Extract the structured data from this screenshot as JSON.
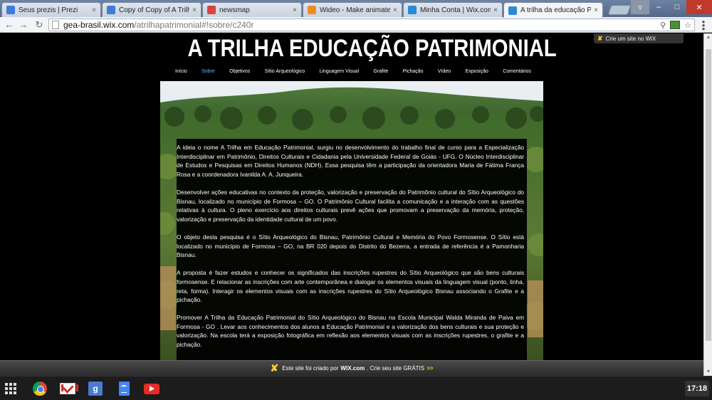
{
  "browser": {
    "tabs": [
      {
        "title": "Seus prezis | Prezi",
        "favicon": "prezi-icon",
        "color": "#3b7dd8"
      },
      {
        "title": "Copy of Copy of A Trilha E",
        "favicon": "prezi-icon",
        "color": "#3b7dd8"
      },
      {
        "title": "newsmap",
        "favicon": "newsmap-icon",
        "color": "#d8443b"
      },
      {
        "title": "Wideo - Make animated o",
        "favicon": "wideo-icon",
        "color": "#f08a24"
      },
      {
        "title": "Minha Conta | Wix.com",
        "favicon": "wix-icon",
        "color": "#2a8ad4"
      },
      {
        "title": "A trilha da educação Patrim",
        "favicon": "wix-icon",
        "color": "#2a8ad4"
      }
    ],
    "url_host": "gea-brasil.wix.com",
    "url_path": "/atrilhapatrimonial#!sobre/c240r"
  },
  "wix_create_badge": "Crie um site no WiX",
  "site": {
    "title": "A TRILHA EDUCAÇÃO PATRIMONIAL",
    "nav": [
      "Início",
      "Sobre",
      "Objetivos",
      "Sítio Arqueológico",
      "Linguagem Visual",
      "Grafite",
      "Pichação",
      "Vídeo",
      "Exposição",
      "Comentários"
    ],
    "current_nav": "Sobre",
    "paragraphs": [
      "A ideia o nome A Trilha em Educação Patrimonial, surgiu no desenvolvimento do trabalho final de curso para a Especialização Interdisciplinar em Patrimônio, Direitos Culturais e Cidadania pela Universidade Federal de Goiás - UFG. O Núcleo Interdisciplinar de Estudos e Pesquisas em Direitos Humanos (NDH).  Essa pesquisa têm a participação da orientadora Maria de Fátima França Rosa e a coordenadora Ivanilda A. A. Junqueira.",
      "Desenvolver ações educativas no contexto da proteção, valorização e preservação do Patrimônio cultural do Sítio Arqueológico do Bisnau, localizado no município de Formosa – GO. O Patrimônio Cultural facilita a comunicação e a interação com as questões relativas à cultura. O pleno exercício aos direitos culturais prevê ações que promovam a preservação da memória, proteção, valorização e preservação da identidade cultural de um povo.",
      "O objeto desta pesquisa é o Sítio Arqueológico do Bisnau, Patrimônio Cultural e Memória do Povo Formosense. O Sítio está localizado no município de Formosa – GO, na BR 020 depois do Distrito do Bezerra, a entrada de referência é a Pamonharia Bisnau.",
      "A proposta é fazer estudos e conhecer os significados das inscrições rupestres do Sítio Arqueológico que são bens culturais formosense. E relacionar as inscrições com arte contemporânea e dialogar os elementos visuais da linguagem visual (ponto, linha, reta, forma). Interagir os elementos visuais com as inscrições rupestres do Sítio Arqueológico Bisnau associando o Grafite e a pichação.",
      "Promover A Trilha da  Educação Patrimonial do Sítio Arqueológico do Bisnau na Escola Municipal Walda Miranda de Paiva em Formosa - GO . Levar aos conhecimentos dos alunos a Educação Patrimonial e a valorização dos bens culturais e sua proteção e valorização.  Na escola terá a exposição fotográfica em reflexão aos elementos visuais com as inscrições rupestres, o grafite e a pichação."
    ]
  },
  "wix_banner": {
    "text": "Este site foi criado por ",
    "brand": "WIX.com",
    "cta": ". Crie seu site GRÁTIS",
    "arrows": ">>"
  },
  "taskbar": {
    "apps": [
      "app-launcher-icon",
      "chrome-icon",
      "gmail-icon",
      "google-plus-icon",
      "google-docs-icon",
      "youtube-icon"
    ],
    "clock": "17:18"
  }
}
